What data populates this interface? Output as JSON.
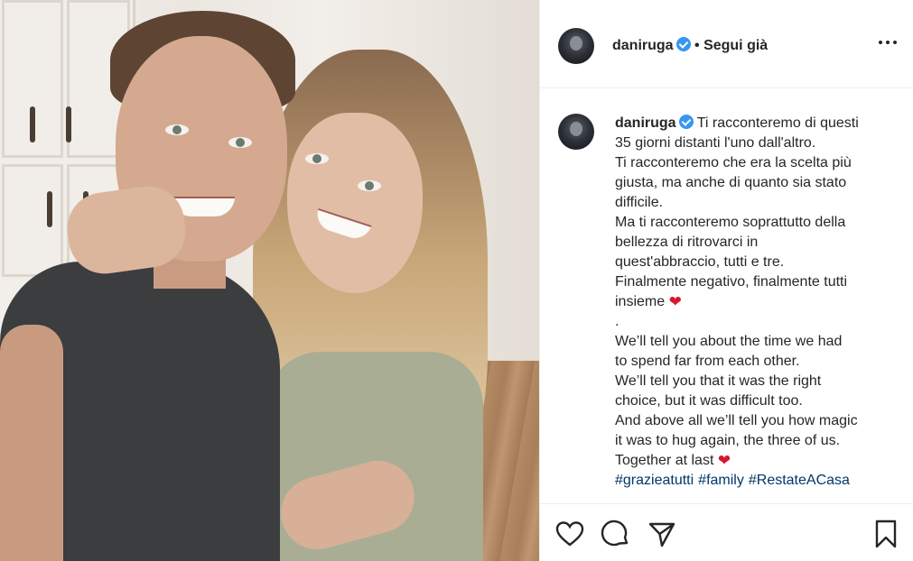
{
  "post": {
    "username": "daniruga",
    "follow_label": "• Segui già",
    "caption_lines": [
      "Ti racconteremo di questi",
      "35 giorni distanti l'uno dall'altro.",
      "Ti racconteremo che era la scelta più",
      "giusta, ma anche di quanto sia stato",
      "difficile.",
      "Ma ti racconteremo soprattutto della",
      "bellezza di ritrovarci in",
      "quest'abbraccio, tutti e tre.",
      "Finalmente negativo, finalmente tutti",
      "insieme",
      ".",
      "We’ll tell you about the time we had",
      "to spend far from each other.",
      "We’ll tell you that it was the right",
      "choice, but it was difficult too.",
      "And above all we’ll tell you how magic",
      "it was to hug again, the three of us.",
      "Together at last"
    ],
    "hashtags": [
      "#grazieatutti",
      "#family",
      "#RestateACasa"
    ],
    "heart_emoji": "❤",
    "colors": {
      "verified": "#3897f0",
      "hashtag": "#00376b",
      "heart": "#d6182e"
    },
    "icons": [
      "heart-icon",
      "comment-icon",
      "share-icon",
      "save-icon",
      "more-icon",
      "verified-badge-icon"
    ]
  }
}
